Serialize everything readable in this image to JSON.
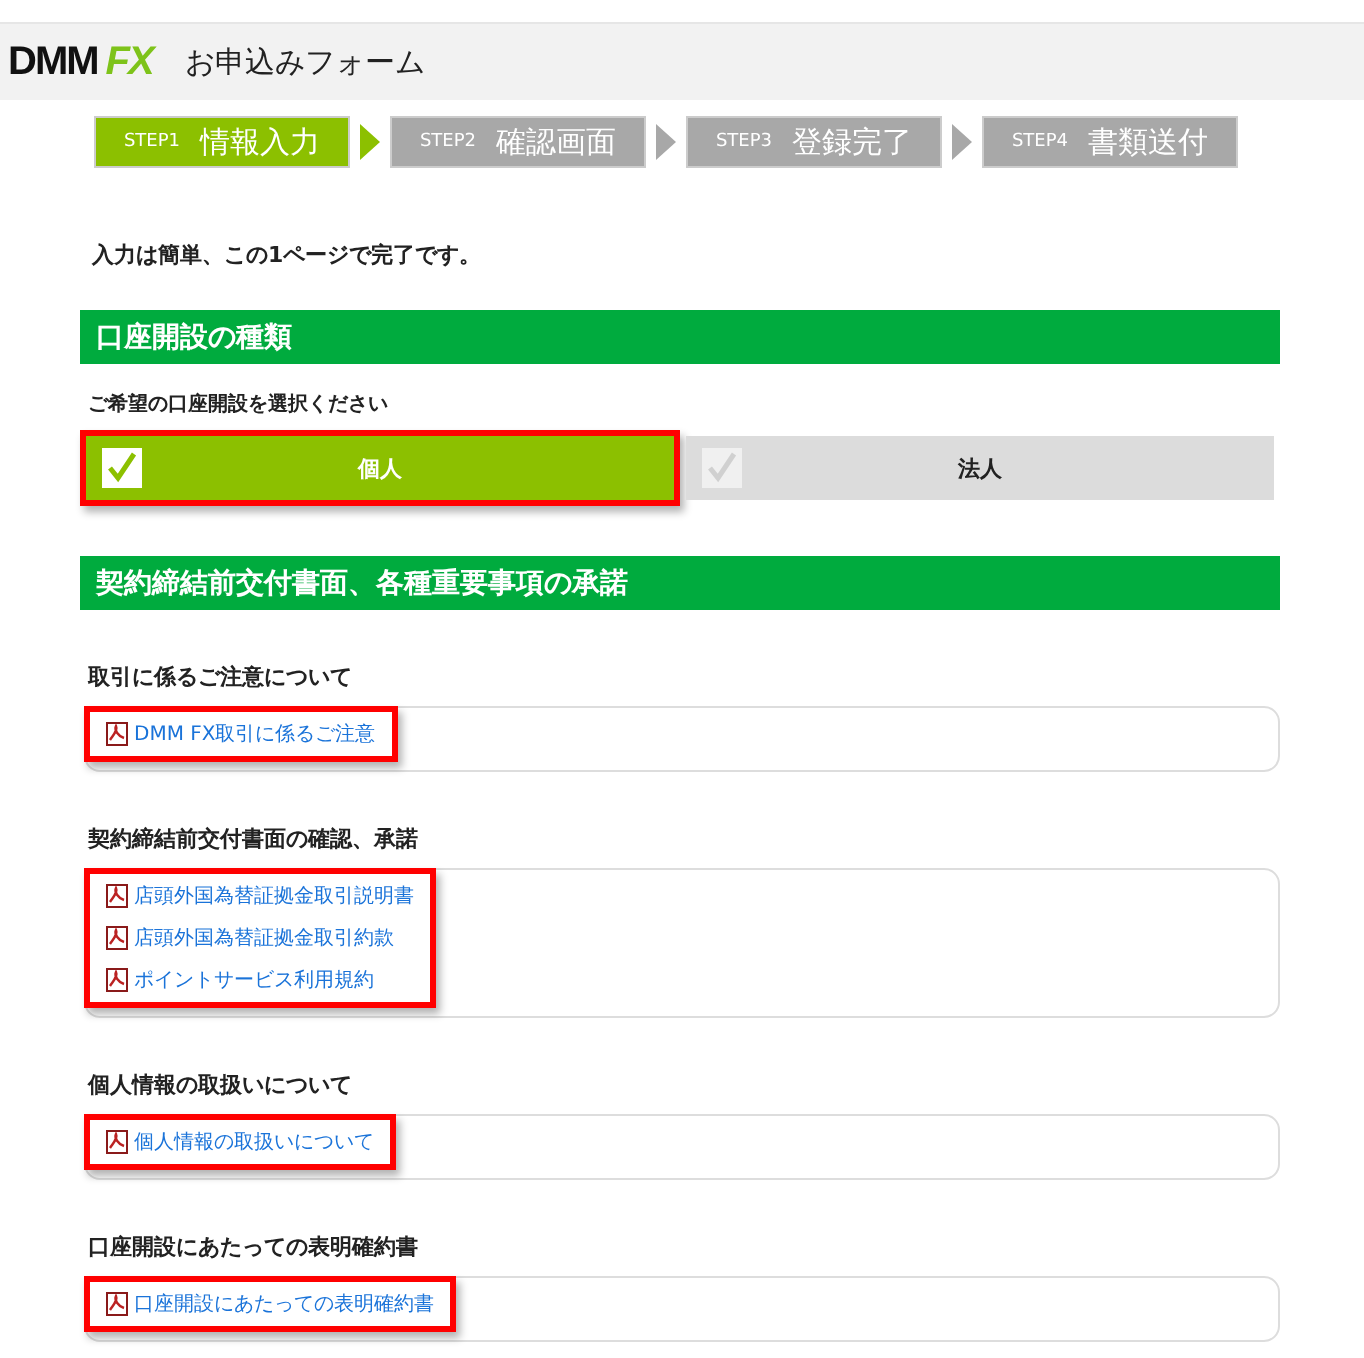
{
  "header": {
    "logo_left": "DMM",
    "logo_right": "FX",
    "title": "お申込みフォーム"
  },
  "steps": [
    {
      "step": "STEP1",
      "label": "情報入力",
      "selected": true
    },
    {
      "step": "STEP2",
      "label": "確認画面",
      "selected": false
    },
    {
      "step": "STEP3",
      "label": "登録完了",
      "selected": false
    },
    {
      "step": "STEP4",
      "label": "書類送付",
      "selected": false
    }
  ],
  "intro": "入力は簡単、この1ページで完了です。",
  "account_section": {
    "title": "口座開設の種類",
    "prompt": "ご希望の口座開設を選択ください",
    "options": [
      {
        "label": "個人",
        "selected": true,
        "highlighted": true
      },
      {
        "label": "法人",
        "selected": false,
        "highlighted": false
      }
    ]
  },
  "documents_section": {
    "title": "契約締結前交付書面、各種重要事項の承諾",
    "groups": [
      {
        "title": "取引に係るご注意について",
        "highlighted": true,
        "links": [
          "DMM FX取引に係るご注意"
        ]
      },
      {
        "title": "契約締結前交付書面の確認、承諾",
        "highlighted": true,
        "links": [
          "店頭外国為替証拠金取引説明書",
          "店頭外国為替証拠金取引約款",
          "ポイントサービス利用規約"
        ]
      },
      {
        "title": "個人情報の取扱いについて",
        "highlighted": true,
        "links": [
          "個人情報の取扱いについて"
        ]
      },
      {
        "title": "口座開設にあたっての表明確約書",
        "highlighted": true,
        "links": [
          "口座開設にあたっての表明確約書"
        ]
      }
    ]
  }
}
